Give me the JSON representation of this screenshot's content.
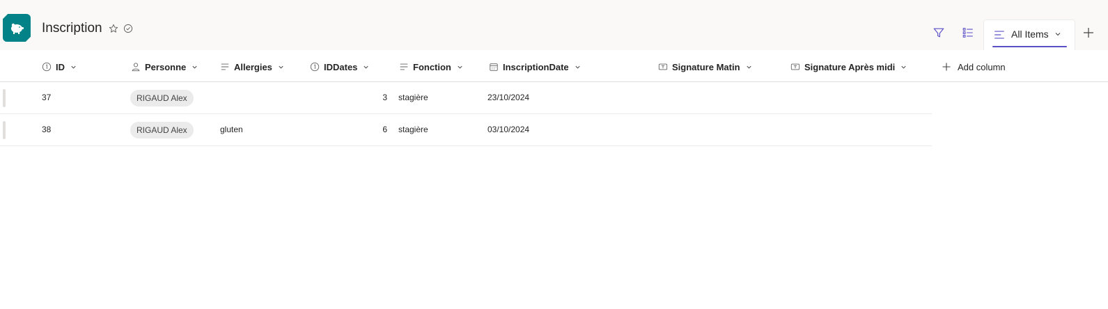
{
  "header": {
    "title": "Inscription",
    "logo_icon": "piggy-bank-icon",
    "brand_color": "#038387",
    "accent_color": "#5b4fc7"
  },
  "toolbar": {
    "view_label": "All Items",
    "add_view": "+"
  },
  "columns": [
    {
      "label": "ID",
      "icon": "number-icon"
    },
    {
      "label": "Personne",
      "icon": "person-icon"
    },
    {
      "label": "Allergies",
      "icon": "text-lines-icon"
    },
    {
      "label": "IDDates",
      "icon": "number-icon"
    },
    {
      "label": "Fonction",
      "icon": "text-lines-icon"
    },
    {
      "label": "InscriptionDate",
      "icon": "calendar-icon"
    },
    {
      "label": "Signature Matin",
      "icon": "textbox-icon"
    },
    {
      "label": "Signature Après midi",
      "icon": "textbox-icon"
    }
  ],
  "add_column_label": "Add column",
  "rows": [
    {
      "id": "37",
      "personne": "RIGAUD Alex",
      "allergies": "",
      "iddates": "3",
      "fonction": "stagière",
      "date": "23/10/2024"
    },
    {
      "id": "38",
      "personne": "RIGAUD Alex",
      "allergies": "gluten",
      "iddates": "6",
      "fonction": "stagière",
      "date": "03/10/2024"
    }
  ]
}
